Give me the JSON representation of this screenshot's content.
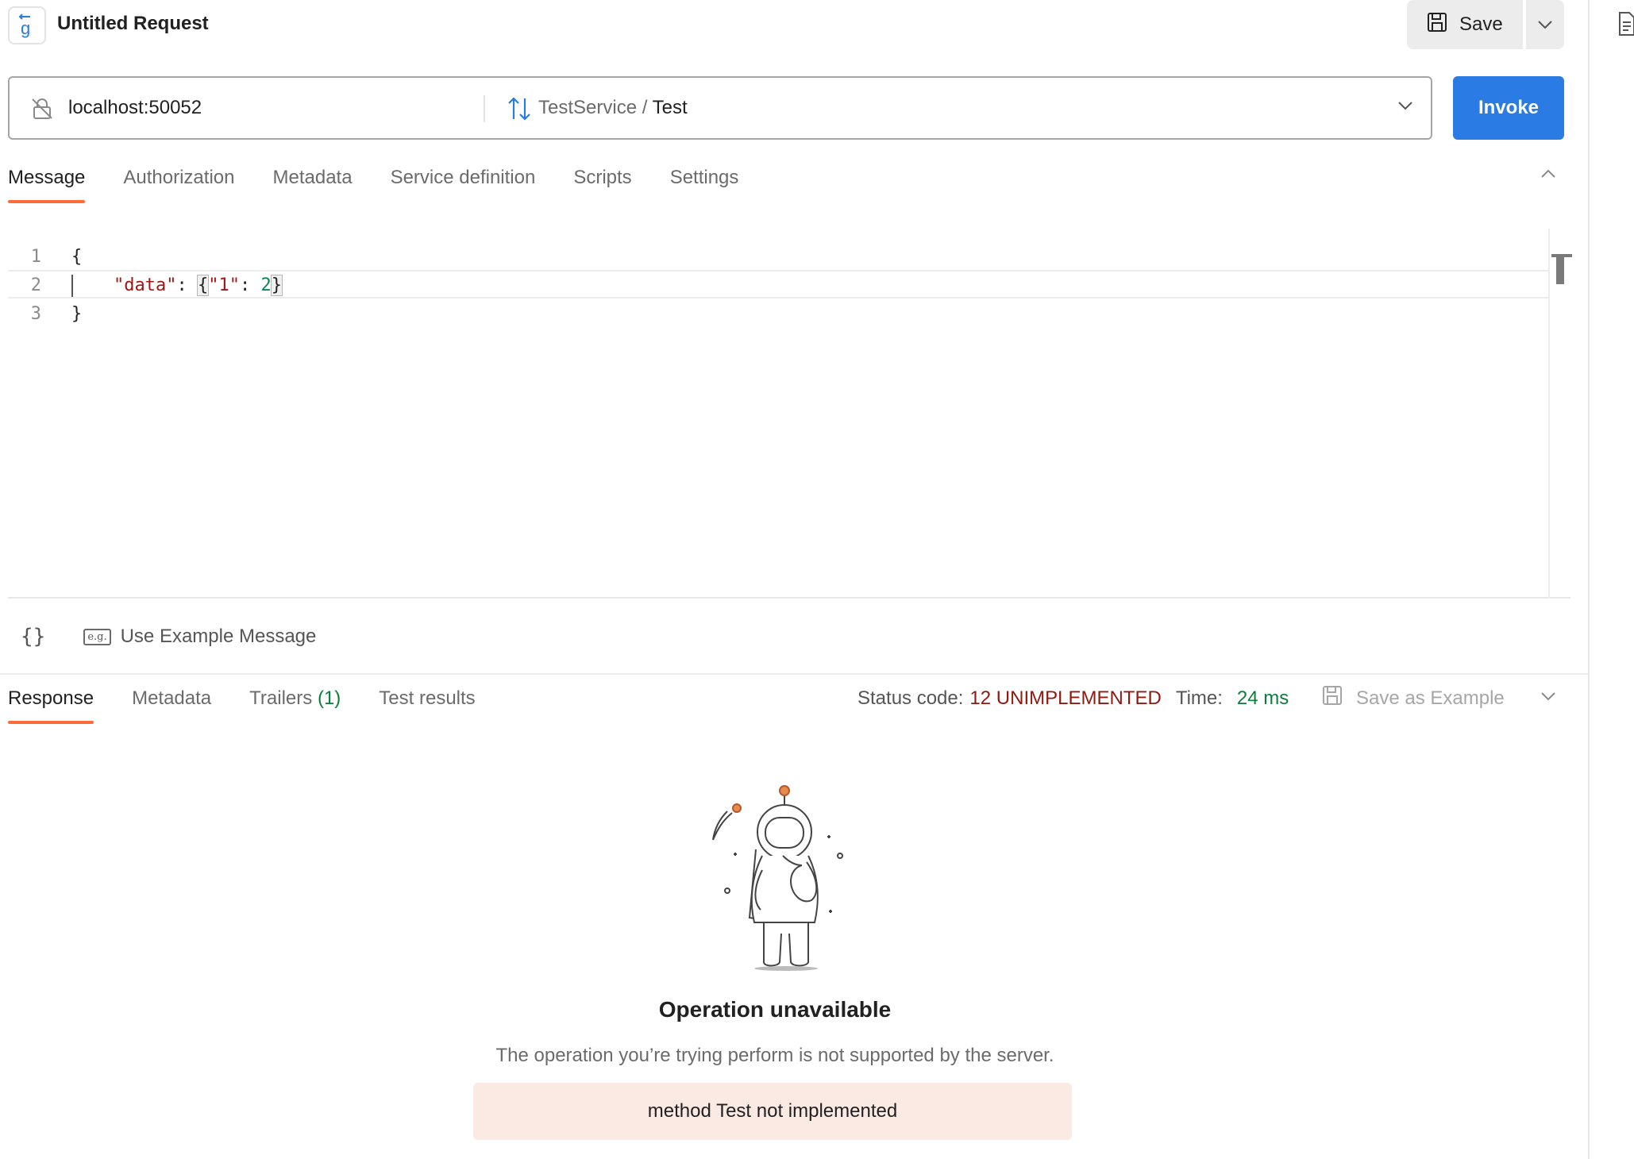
{
  "header": {
    "title": "Untitled Request",
    "save_label": "Save"
  },
  "url_bar": {
    "host": "localhost:50052",
    "service": "TestService",
    "separator": "/",
    "method": "Test",
    "invoke_label": "Invoke"
  },
  "request_tabs": [
    {
      "label": "Message",
      "active": true
    },
    {
      "label": "Authorization",
      "active": false
    },
    {
      "label": "Metadata",
      "active": false
    },
    {
      "label": "Service definition",
      "active": false
    },
    {
      "label": "Scripts",
      "active": false
    },
    {
      "label": "Settings",
      "active": false
    }
  ],
  "editor": {
    "line_numbers": [
      "1",
      "2",
      "3"
    ],
    "line1": "{",
    "line2_key": "\"data\"",
    "line2_colon": ": ",
    "line2_open": "{",
    "line2_inner_key": "\"1\"",
    "line2_inner_colon": ": ",
    "line2_value": "2",
    "line2_close": "}",
    "line3": "}"
  },
  "editor_footer": {
    "braces_label": "{}",
    "eg_icon_label": "e.g.",
    "use_example_label": "Use Example Message"
  },
  "response_tabs": [
    {
      "label": "Response",
      "active": true
    },
    {
      "label": "Metadata",
      "active": false
    },
    {
      "label": "Trailers",
      "count": "(1)",
      "active": false
    },
    {
      "label": "Test results",
      "active": false
    }
  ],
  "status": {
    "status_label": "Status code:",
    "status_value": "12 UNIMPLEMENTED",
    "time_label": "Time:",
    "time_value": "24 ms",
    "save_example_label": "Save as Example"
  },
  "empty_state": {
    "title": "Operation unavailable",
    "description": "The operation you’re trying perform is not supported by the server.",
    "error_message": "method Test not implemented"
  },
  "colors": {
    "accent_tab": "#ff6c37",
    "invoke_button": "#2b7be4",
    "status_error": "#8e1a10",
    "time_ok": "#0b7f3a",
    "error_box_bg": "#fbe9e4"
  },
  "icons": [
    "grpc-request-icon",
    "save-icon",
    "chevron-down-icon",
    "insecure-lock-icon",
    "bidirectional-arrows-icon",
    "chevron-up-icon",
    "braces-icon",
    "example-icon",
    "astronaut-illustration",
    "document-icon"
  ]
}
